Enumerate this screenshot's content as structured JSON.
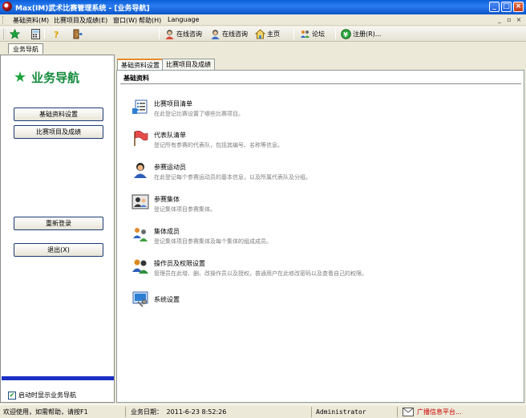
{
  "window": {
    "title": "Max(IM)武术比赛管理系统 - [业务导航]",
    "controls": [
      "_",
      "□",
      "×"
    ]
  },
  "menubar": {
    "items": [
      "基础资料(M)",
      "比赛项目及成绩(E)",
      "窗口(W)",
      "帮助(H)",
      "Language"
    ],
    "mdi_controls": [
      "_",
      "▫",
      "×"
    ]
  },
  "toolbar": {
    "buttons": [
      {
        "icon": "green-star-icon",
        "label": ""
      },
      {
        "icon": "calculator-icon",
        "label": ""
      },
      {
        "icon": "help-icon",
        "label": ""
      },
      {
        "icon": "exit-door-icon",
        "label": ""
      },
      {
        "icon": "online-consult-icon",
        "label": "在线咨询"
      },
      {
        "icon": "online-consult-icon",
        "label": "在线咨询"
      },
      {
        "icon": "home-icon",
        "label": "主页"
      },
      {
        "icon": "forum-icon",
        "label": "论坛"
      },
      {
        "icon": "register-icon",
        "label": "注册(R)..."
      }
    ]
  },
  "doc_tabs": [
    "业务导航"
  ],
  "left_nav": {
    "title": "业务导航",
    "buttons": [
      "基础资料设置",
      "比赛项目及成绩",
      "重新登录",
      "退出(X)"
    ],
    "show_on_startup": {
      "label": "启动时显示业务导航",
      "checked": true
    }
  },
  "main": {
    "tabs": [
      "基础资料设置",
      "比赛项目及成绩"
    ],
    "active_tab": 0,
    "section_title": "基础资料",
    "items": [
      {
        "icon": "event-list-icon",
        "title": "比赛项目清单",
        "desc": "在此登记比赛设置了哪些比赛项目。"
      },
      {
        "icon": "flag-icon",
        "title": "代表队清单",
        "desc": "登记所有参赛的代表队，包括其编号、名称等信息。"
      },
      {
        "icon": "athlete-icon",
        "title": "参赛运动员",
        "desc": "在此登记每个参赛运动员的基本信息，以及所属代表队及分组。"
      },
      {
        "icon": "team-icon",
        "title": "参赛集体",
        "desc": "登记集体项目参赛集体。"
      },
      {
        "icon": "group-members-icon",
        "title": "集体成员",
        "desc": "登记集体项目参赛集体及每个集体的组成成员。"
      },
      {
        "icon": "operator-permissions-icon",
        "title": "操作员及权限设置",
        "desc": "管理员在此增、删、改操作员以及授权，普通用户在此修改密码以及查看自己的权限。"
      },
      {
        "icon": "system-settings-icon",
        "title": "系统设置",
        "desc": ""
      }
    ]
  },
  "statusbar": {
    "welcome": "欢迎使用，如需帮助，请按F1",
    "business_date_label": "业务日期：",
    "business_date": "2011-6-23 8:52:26",
    "user": "Administrator",
    "broadcast": "广播信息平台..."
  },
  "colors": {
    "title_bar": "#0A5FD8",
    "nav_title": "#128A3B",
    "left_blue_bar": "#1A2FC4",
    "active_tab_accent": "#E68B2C",
    "broadcast_text": "#CC0000"
  }
}
